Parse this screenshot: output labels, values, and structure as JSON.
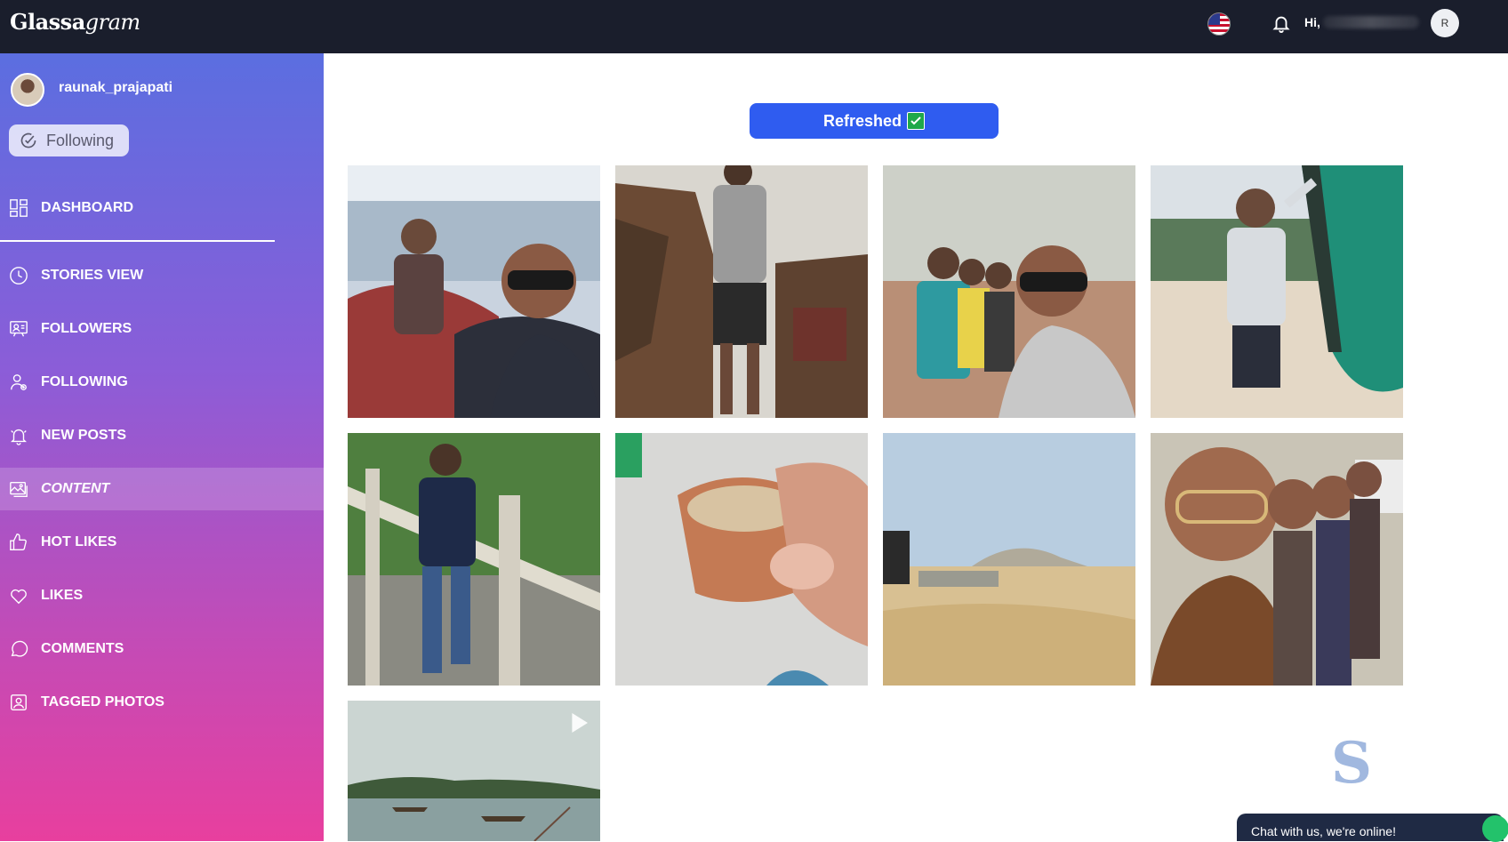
{
  "header": {
    "logo_regular": "Glassa",
    "logo_italic": "gram",
    "greeting": "Hi,",
    "avatar_initial": "R"
  },
  "sidebar": {
    "username": "raunak_prajapati",
    "follow_button": "Following",
    "items": [
      {
        "label": "DASHBOARD",
        "icon": "dashboard-icon"
      },
      {
        "label": "STORIES VIEW",
        "icon": "clock-icon"
      },
      {
        "label": "FOLLOWERS",
        "icon": "followers-icon"
      },
      {
        "label": "FOLLOWING",
        "icon": "user-add-icon"
      },
      {
        "label": "NEW POSTS",
        "icon": "bell-icon"
      },
      {
        "label": "CONTENT",
        "icon": "image-icon",
        "active": true
      },
      {
        "label": "HOT LIKES",
        "icon": "thumbs-up-icon"
      },
      {
        "label": "LIKES",
        "icon": "heart-icon"
      },
      {
        "label": "COMMENTS",
        "icon": "comment-icon"
      },
      {
        "label": "TAGGED PHOTOS",
        "icon": "tagged-photo-icon"
      }
    ]
  },
  "main": {
    "refresh_button": "Refreshed",
    "posts": [
      {
        "subject": "two men selfie on boat at sea",
        "type": "photo"
      },
      {
        "subject": "man standing by laterite stone wall",
        "type": "photo"
      },
      {
        "subject": "group selfie of four friends",
        "type": "photo"
      },
      {
        "subject": "man posing by green boat on beach",
        "type": "photo"
      },
      {
        "subject": "man leaning on concrete railing",
        "type": "photo"
      },
      {
        "subject": "hand holding clay cup of tea",
        "type": "photo"
      },
      {
        "subject": "sandy landscape with distant hill",
        "type": "photo"
      },
      {
        "subject": "group selfie of men in suits",
        "type": "photo"
      },
      {
        "subject": "river with boats",
        "type": "video"
      }
    ]
  },
  "chat_widget": {
    "label": "Chat with us, we're online!"
  },
  "colors": {
    "topbar": "#1a1e2c",
    "sidebar_top": "#5b6ee0",
    "sidebar_bottom": "#e83f9e",
    "button_blue": "#2f5cf0",
    "check_green": "#1fa84a"
  }
}
